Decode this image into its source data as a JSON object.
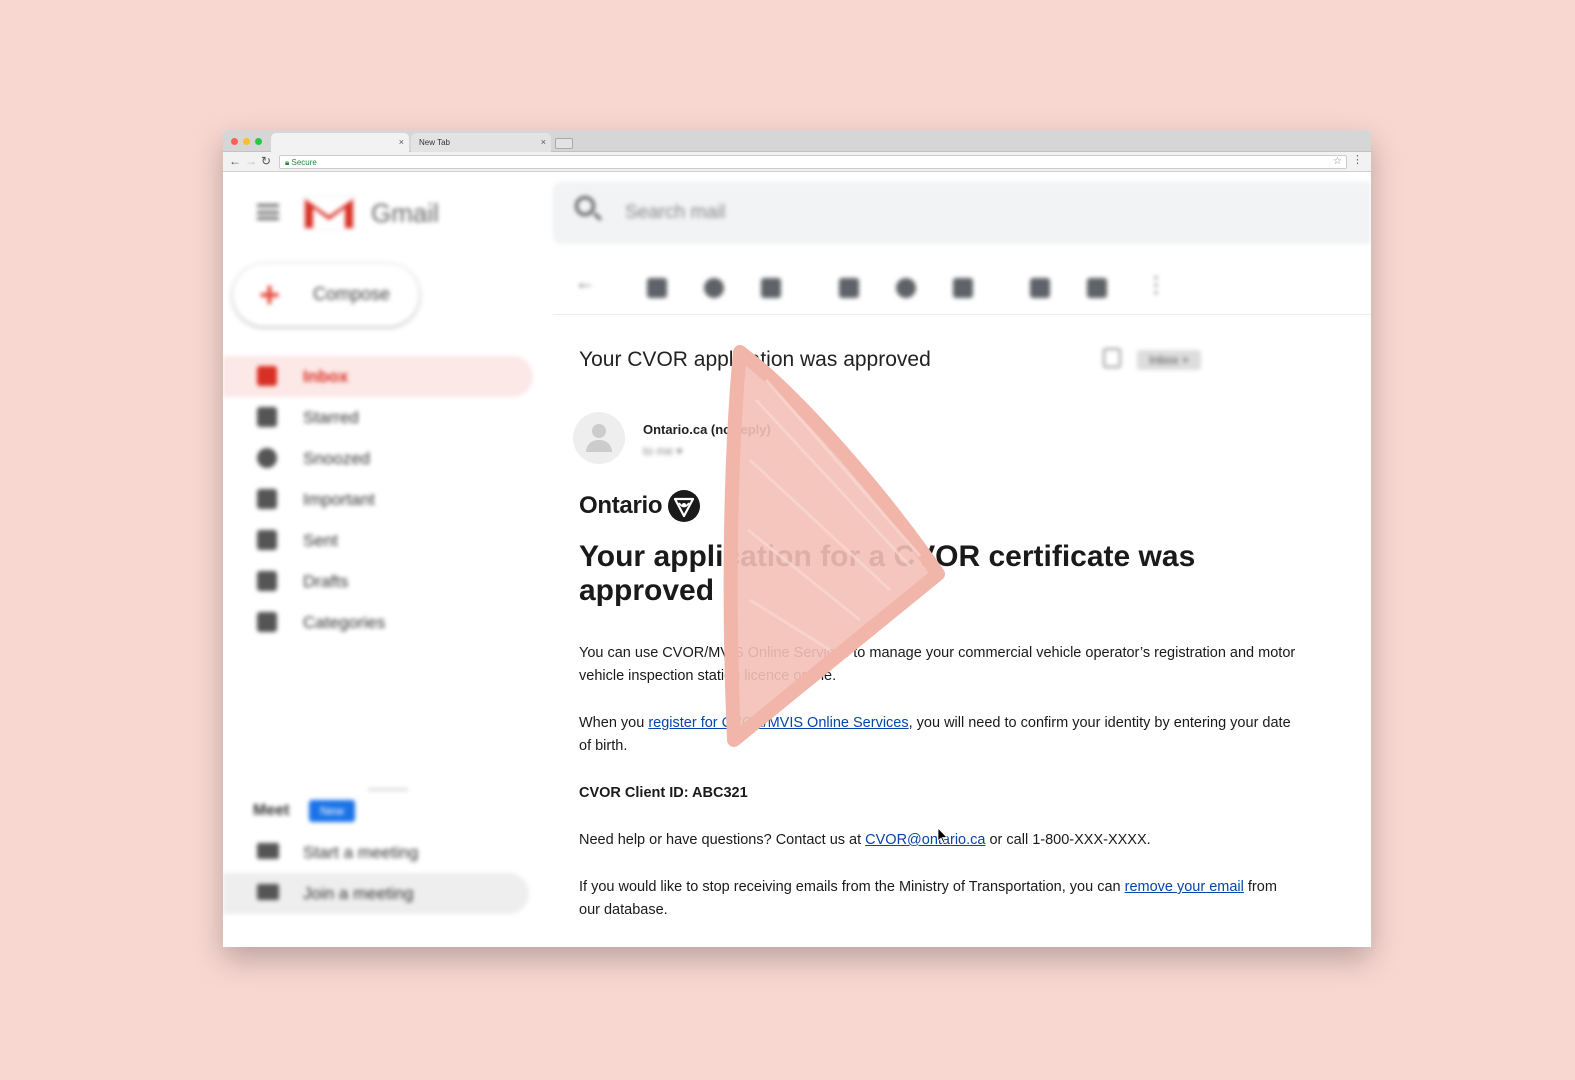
{
  "browser": {
    "tabs": [
      {
        "label": "",
        "close": "×"
      },
      {
        "label": "New Tab",
        "close": "×"
      }
    ],
    "address": {
      "secure_label": "Secure",
      "url": ""
    },
    "back_glyph": "←",
    "forward_glyph": "→",
    "reload_glyph": "↻",
    "star_glyph": "☆",
    "menu_glyph": "⋮"
  },
  "gmail": {
    "product_name": "Gmail",
    "compose_label": "Compose",
    "nav": [
      {
        "label": "Inbox",
        "icon": "inbox-icon",
        "active": true
      },
      {
        "label": "Starred",
        "icon": "star-icon"
      },
      {
        "label": "Snoozed",
        "icon": "clock-icon"
      },
      {
        "label": "Important",
        "icon": "important-icon"
      },
      {
        "label": "Sent",
        "icon": "send-icon"
      },
      {
        "label": "Drafts",
        "icon": "draft-icon"
      },
      {
        "label": "Categories",
        "icon": "label-icon"
      }
    ],
    "meet": {
      "title": "Meet",
      "badge": "New",
      "items": [
        {
          "label": "Start a meeting",
          "icon": "video-icon"
        },
        {
          "label": "Join a meeting",
          "icon": "keyboard-icon"
        }
      ]
    },
    "search_placeholder": "Search mail"
  },
  "message": {
    "subject": "Your CVOR application was approved",
    "inbox_chip": "Inbox ×",
    "sender": "Ontario.ca (no-reply)",
    "to": "to me ▾",
    "brand": "Ontario",
    "headline": "Your application for a CVOR certificate was approved",
    "p1": "You can use CVOR/MVIS Online Services to manage your commercial vehicle operator’s registration and motor vehicle inspection station licence online.",
    "p2_before": "When you ",
    "p2_link": "register for CVOR/MVIS Online Services",
    "p2_after": ", you will need to confirm your identity by entering your date of birth.",
    "client_id": "CVOR Client ID: ABC321",
    "p4_before": "Need help or have questions? Contact us at ",
    "p4_link": "CVOR@ontario.ca",
    "p4_after": " or call 1-800-XXX-XXXX.",
    "p5_before": "If you would like to stop receiving emails from the Ministry of Transportation, you can ",
    "p5_link": "remove your email",
    "p5_after": " from our database."
  },
  "colors": {
    "background": "#f8d7d1",
    "gmail_red": "#d93025",
    "link": "#0645ad",
    "pen_stroke": "#f3c0b6"
  }
}
